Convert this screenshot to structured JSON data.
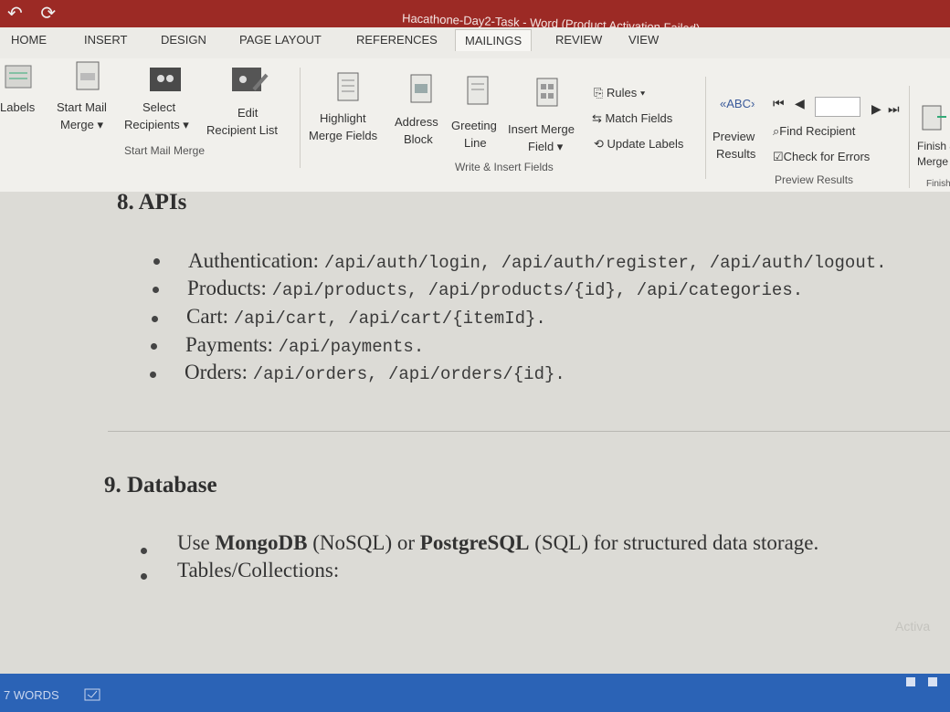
{
  "window": {
    "title": "Hacathone-Day2-Task - Word (Product Activation Failed)"
  },
  "tabs": [
    "HOME",
    "INSERT",
    "DESIGN",
    "PAGE LAYOUT",
    "REFERENCES",
    "MAILINGS",
    "REVIEW",
    "VIEW"
  ],
  "active_tab": "MAILINGS",
  "ribbon": {
    "labels_btn": "Labels",
    "start_mail_merge": [
      "Start Mail",
      "Merge ▾"
    ],
    "select_recipients": [
      "Select",
      "Recipients ▾"
    ],
    "edit_recipient_list": [
      "Edit",
      "Recipient List"
    ],
    "group_start": "Start Mail Merge",
    "highlight": [
      "Highlight",
      "Merge Fields"
    ],
    "address_block": [
      "Address",
      "Block"
    ],
    "greeting_line": [
      "Greeting",
      "Line"
    ],
    "insert_merge_field": [
      "Insert Merge",
      "Field ▾"
    ],
    "rules": "Rules ▾",
    "match_fields": "Match Fields",
    "update_labels": "Update Labels",
    "group_write": "Write & Insert Fields",
    "preview_results": [
      "Preview",
      "Results"
    ],
    "find_recipient": "Find Recipient",
    "check_errors": "Check for Errors",
    "group_preview": "Preview Results",
    "finish_merge": [
      "Finish &",
      "Merge ▾"
    ],
    "group_finish": "Finish"
  },
  "document": {
    "section8": "8. APIs",
    "api_items": [
      {
        "label": "Authentication:",
        "code": "/api/auth/login, /api/auth/register, /api/auth/logout."
      },
      {
        "label": "Products:",
        "code": "/api/products, /api/products/{id}, /api/categories."
      },
      {
        "label": "Cart:",
        "code": "/api/cart, /api/cart/{itemId}."
      },
      {
        "label": "Payments:",
        "code": "/api/payments."
      },
      {
        "label": "Orders:",
        "code": "/api/orders, /api/orders/{id}."
      }
    ],
    "section9": "9. Database",
    "db_item1": {
      "pre": "Use ",
      "b1": "MongoDB",
      "mid1": " (NoSQL) or ",
      "b2": "PostgreSQL",
      "post": " (SQL) for structured data storage."
    },
    "db_item2": "Tables/Collections:"
  },
  "status": {
    "words": "7 WORDS"
  },
  "watermark": "Activa"
}
